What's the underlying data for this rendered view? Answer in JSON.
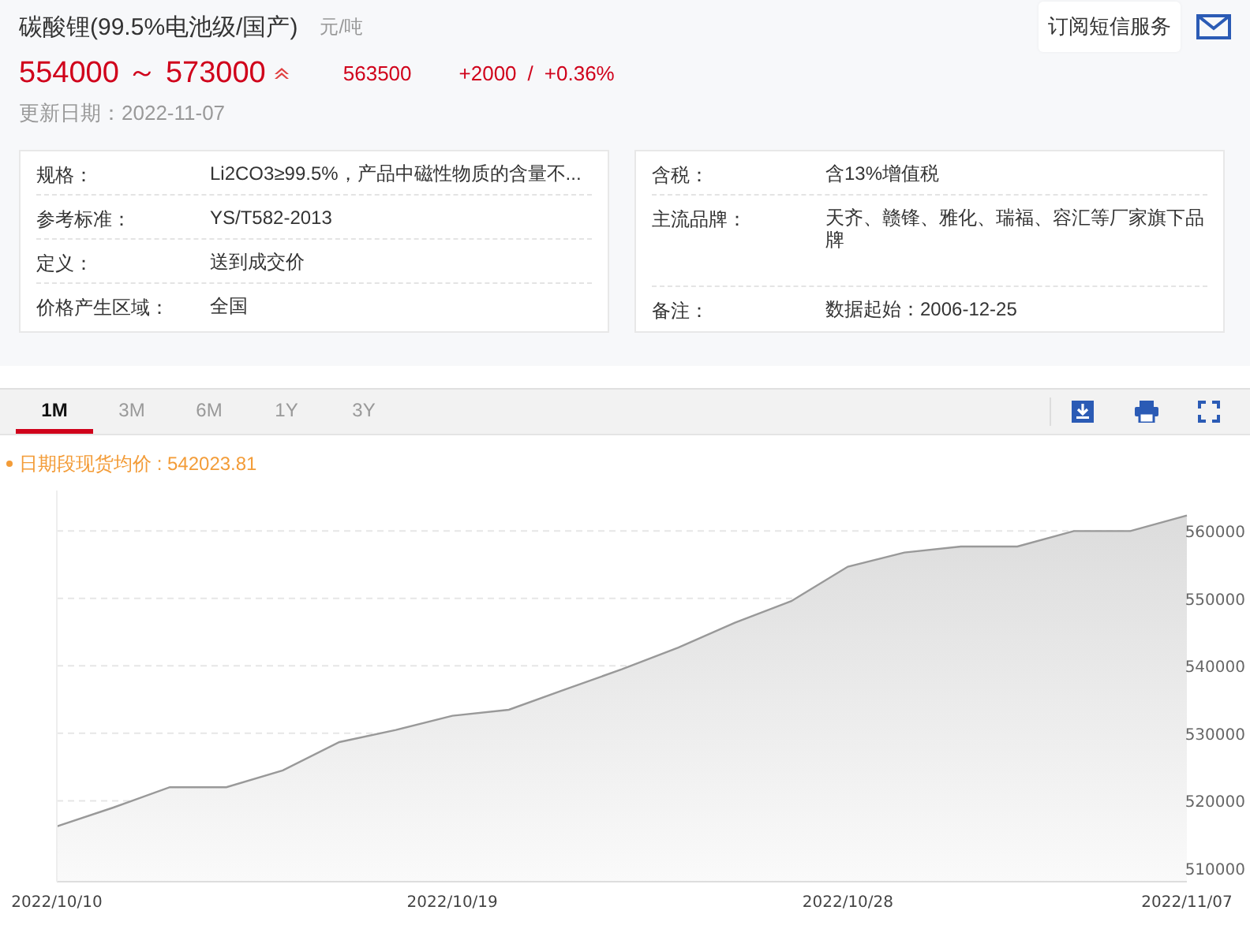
{
  "product": {
    "title": "碳酸锂(99.5%电池级/国产)",
    "unit": "元/吨",
    "price_range": "554000 ～ 573000",
    "trend_up": true,
    "average": "563500",
    "change": "+2000",
    "separator": "/",
    "change_percent": "+0.36%",
    "updated": "更新日期：2022-11-07"
  },
  "subscribe": {
    "label": "订阅短信服务"
  },
  "specs_left": [
    {
      "label": "规格：",
      "value": "Li2CO3≥99.5%，产品中磁性物质的含量不..."
    },
    {
      "label": "参考标准：",
      "value": "YS/T582-2013"
    },
    {
      "label": "定义：",
      "value": "送到成交价"
    },
    {
      "label": "价格产生区域：",
      "value": "全国"
    }
  ],
  "specs_right": [
    {
      "label": "含税：",
      "value": "含13%增值税"
    },
    {
      "label": "主流品牌：",
      "value": "天齐、赣锋、雅化、瑞福、容汇等厂家旗下品牌"
    },
    {
      "label": "备注：",
      "value": "数据起始：2006-12-25"
    }
  ],
  "tabs": [
    {
      "label": "1M",
      "selected": true
    },
    {
      "label": "3M",
      "selected": false
    },
    {
      "label": "6M",
      "selected": false
    },
    {
      "label": "1Y",
      "selected": false
    },
    {
      "label": "3Y",
      "selected": false
    }
  ],
  "average_label": "日期段现货均价 : 542023.81",
  "chart": {
    "chart_data": {
      "type": "area",
      "categories": [
        "2022/10/10",
        null,
        null,
        null,
        null,
        null,
        null,
        "2022/10/19",
        null,
        null,
        null,
        null,
        null,
        null,
        "2022/10/28",
        null,
        null,
        null,
        null,
        null,
        "2022/11/07"
      ],
      "grid": true,
      "ylim": [
        508000,
        566000
      ],
      "values": [
        516200,
        519000,
        522000,
        522000,
        524500,
        528700,
        530500,
        532600,
        533500,
        536500,
        539500,
        542700,
        546400,
        549600,
        554700,
        556800,
        557700,
        557700,
        560000,
        560000,
        562300
      ],
      "yticks": [
        510000,
        520000,
        530000,
        540000,
        550000,
        560000
      ]
    }
  }
}
